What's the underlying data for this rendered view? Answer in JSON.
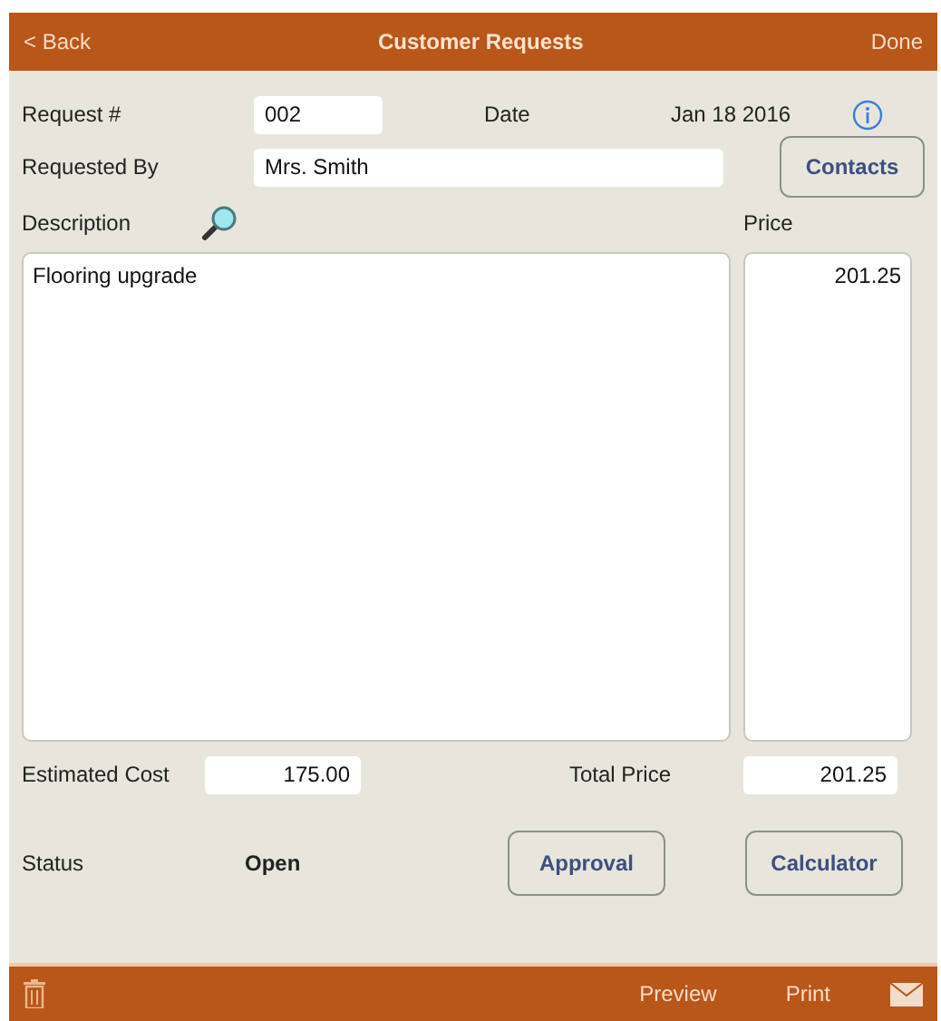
{
  "nav_bar": {
    "back": "< Back",
    "title": "Customer Requests",
    "done": "Done"
  },
  "request": {
    "label": "Request #",
    "value": "002"
  },
  "date": {
    "label": "Date",
    "value": "Jan 18 2016"
  },
  "requested_by": {
    "label": "Requested By",
    "value": "Mrs. Smith"
  },
  "contacts_button": "Contacts",
  "description": {
    "label": "Description",
    "value": "Flooring upgrade"
  },
  "price": {
    "label": "Price",
    "value": "201.25"
  },
  "estimated_cost": {
    "label": "Estimated Cost",
    "value": "175.00"
  },
  "total_price": {
    "label": "Total Price",
    "value": "201.25"
  },
  "status": {
    "label": "Status",
    "value": "Open"
  },
  "buttons": [
    "Approval",
    "Calculator"
  ],
  "toolbar": {
    "items": [
      "Preview",
      "Print"
    ]
  }
}
